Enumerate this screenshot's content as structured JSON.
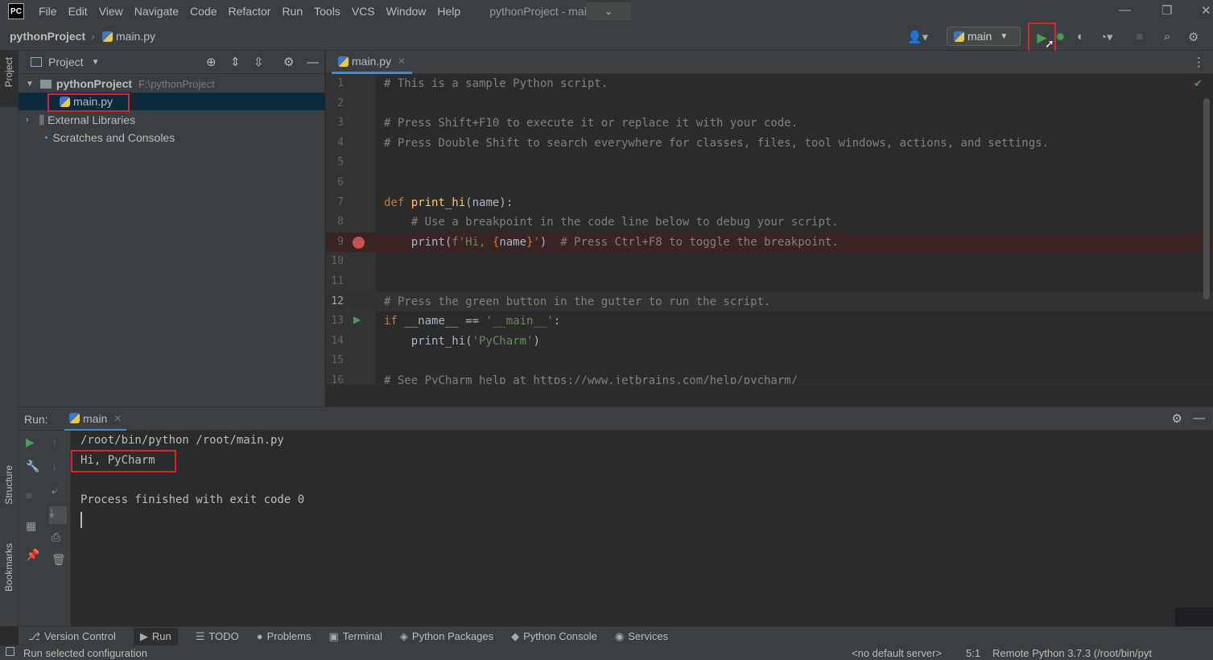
{
  "app": {
    "logo_text": "PC",
    "title": "pythonProject - main.py",
    "menu": [
      "File",
      "Edit",
      "View",
      "Navigate",
      "Code",
      "Refactor",
      "Run",
      "Tools",
      "VCS",
      "Window",
      "Help"
    ]
  },
  "breadcrumb": {
    "project": "pythonProject",
    "separator": "›",
    "file": "main.py"
  },
  "toolbar": {
    "run_config": "main"
  },
  "left_stripe": {
    "project": "Project",
    "structure": "Structure",
    "bookmarks": "Bookmarks"
  },
  "project_panel": {
    "title": "Project",
    "tree": {
      "root_name": "pythonProject",
      "root_path": "F:\\pythonProject",
      "file": "main.py",
      "external": "External Libraries",
      "scratches": "Scratches and Consoles"
    }
  },
  "editor": {
    "tab": "main.py",
    "lines": [
      {
        "n": "1",
        "parts": [
          [
            "cm",
            "# This is a sample Python script."
          ]
        ]
      },
      {
        "n": "2",
        "parts": []
      },
      {
        "n": "3",
        "parts": [
          [
            "cm",
            "# Press Shift+F10 to execute it or replace it with your code."
          ]
        ]
      },
      {
        "n": "4",
        "parts": [
          [
            "cm",
            "# Press Double Shift to search everywhere for classes, files, tool windows, actions, and settings."
          ]
        ]
      },
      {
        "n": "5",
        "parts": []
      },
      {
        "n": "6",
        "parts": []
      },
      {
        "n": "7",
        "parts": [
          [
            "kw",
            "def "
          ],
          [
            "fn",
            "print_hi"
          ],
          [
            "tx",
            "(name):"
          ]
        ]
      },
      {
        "n": "8",
        "parts": [
          [
            "cm",
            "    # Use a breakpoint in the code line below to debug your script."
          ]
        ]
      },
      {
        "n": "9",
        "parts": [
          [
            "tx",
            "    print("
          ],
          [
            "st",
            "f'Hi, "
          ],
          [
            "kw",
            "{"
          ],
          [
            "tx",
            "name"
          ],
          [
            "kw",
            "}"
          ],
          [
            "st",
            "'"
          ],
          [
            "tx",
            ")  "
          ],
          [
            "cm",
            "# Press Ctrl+F8 to toggle the breakpoint."
          ]
        ]
      },
      {
        "n": "10",
        "parts": []
      },
      {
        "n": "11",
        "parts": []
      },
      {
        "n": "12",
        "parts": [
          [
            "cm",
            "# Press the green button in the gutter to run the script."
          ]
        ]
      },
      {
        "n": "13",
        "parts": [
          [
            "kw",
            "if "
          ],
          [
            "tx",
            "__name__ == "
          ],
          [
            "st",
            "'__main__'"
          ],
          [
            "tx",
            ":"
          ]
        ]
      },
      {
        "n": "14",
        "parts": [
          [
            "tx",
            "    print_hi("
          ],
          [
            "st",
            "'PyCharm'"
          ],
          [
            "tx",
            ")"
          ]
        ]
      },
      {
        "n": "15",
        "parts": []
      },
      {
        "n": "16",
        "parts": [
          [
            "cm",
            "# See PyCharm help at https://www.jetbrains.com/help/pycharm/"
          ]
        ]
      }
    ]
  },
  "run_panel": {
    "label": "Run:",
    "tab": "main",
    "console": [
      "/root/bin/python /root/main.py",
      "Hi, PyCharm",
      "",
      "Process finished with exit code 0"
    ]
  },
  "bottom_tabs": [
    "Version Control",
    "Run",
    "TODO",
    "Problems",
    "Terminal",
    "Python Packages",
    "Python Console",
    "Services"
  ],
  "status": {
    "message": "Run selected configuration",
    "server": "<no default server>",
    "position": "5:1",
    "interpreter": "Remote Python 3.7.3 (/root/bin/pyt"
  }
}
